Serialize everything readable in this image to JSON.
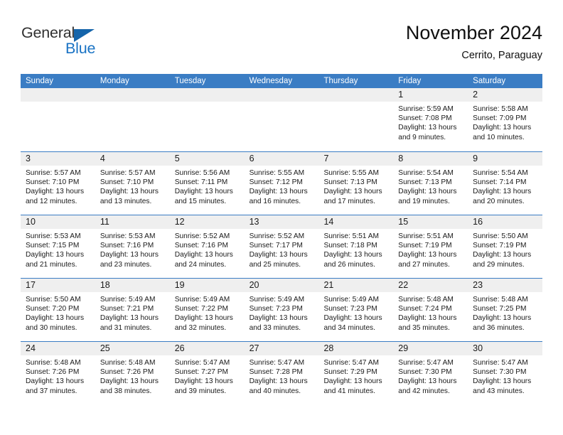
{
  "brand": {
    "name_top": "General",
    "name_bottom": "Blue",
    "triangle_color": "#1464aa",
    "top_color": "#303030",
    "bottom_color": "#1a73c4"
  },
  "header": {
    "title": "November 2024",
    "subtitle": "Cerrito, Paraguay"
  },
  "theme": {
    "header_bg": "#3b7dc4",
    "row_divider": "#3b7dc4",
    "daynum_bg": "#efefef",
    "text": "#1a1a1a"
  },
  "weekdays": [
    "Sunday",
    "Monday",
    "Tuesday",
    "Wednesday",
    "Thursday",
    "Friday",
    "Saturday"
  ],
  "labels": {
    "sunrise_prefix": "Sunrise:",
    "sunset_prefix": "Sunset:",
    "daylight_prefix": "Daylight:"
  },
  "weeks": [
    [
      {
        "day": "",
        "sunrise": "",
        "sunset": "",
        "daylight": "",
        "empty": true
      },
      {
        "day": "",
        "sunrise": "",
        "sunset": "",
        "daylight": "",
        "empty": true
      },
      {
        "day": "",
        "sunrise": "",
        "sunset": "",
        "daylight": "",
        "empty": true
      },
      {
        "day": "",
        "sunrise": "",
        "sunset": "",
        "daylight": "",
        "empty": true
      },
      {
        "day": "",
        "sunrise": "",
        "sunset": "",
        "daylight": "",
        "empty": true
      },
      {
        "day": "1",
        "sunrise": "Sunrise: 5:59 AM",
        "sunset": "Sunset: 7:08 PM",
        "daylight": "Daylight: 13 hours and 9 minutes.",
        "empty": false
      },
      {
        "day": "2",
        "sunrise": "Sunrise: 5:58 AM",
        "sunset": "Sunset: 7:09 PM",
        "daylight": "Daylight: 13 hours and 10 minutes.",
        "empty": false
      }
    ],
    [
      {
        "day": "3",
        "sunrise": "Sunrise: 5:57 AM",
        "sunset": "Sunset: 7:10 PM",
        "daylight": "Daylight: 13 hours and 12 minutes.",
        "empty": false
      },
      {
        "day": "4",
        "sunrise": "Sunrise: 5:57 AM",
        "sunset": "Sunset: 7:10 PM",
        "daylight": "Daylight: 13 hours and 13 minutes.",
        "empty": false
      },
      {
        "day": "5",
        "sunrise": "Sunrise: 5:56 AM",
        "sunset": "Sunset: 7:11 PM",
        "daylight": "Daylight: 13 hours and 15 minutes.",
        "empty": false
      },
      {
        "day": "6",
        "sunrise": "Sunrise: 5:55 AM",
        "sunset": "Sunset: 7:12 PM",
        "daylight": "Daylight: 13 hours and 16 minutes.",
        "empty": false
      },
      {
        "day": "7",
        "sunrise": "Sunrise: 5:55 AM",
        "sunset": "Sunset: 7:13 PM",
        "daylight": "Daylight: 13 hours and 17 minutes.",
        "empty": false
      },
      {
        "day": "8",
        "sunrise": "Sunrise: 5:54 AM",
        "sunset": "Sunset: 7:13 PM",
        "daylight": "Daylight: 13 hours and 19 minutes.",
        "empty": false
      },
      {
        "day": "9",
        "sunrise": "Sunrise: 5:54 AM",
        "sunset": "Sunset: 7:14 PM",
        "daylight": "Daylight: 13 hours and 20 minutes.",
        "empty": false
      }
    ],
    [
      {
        "day": "10",
        "sunrise": "Sunrise: 5:53 AM",
        "sunset": "Sunset: 7:15 PM",
        "daylight": "Daylight: 13 hours and 21 minutes.",
        "empty": false
      },
      {
        "day": "11",
        "sunrise": "Sunrise: 5:53 AM",
        "sunset": "Sunset: 7:16 PM",
        "daylight": "Daylight: 13 hours and 23 minutes.",
        "empty": false
      },
      {
        "day": "12",
        "sunrise": "Sunrise: 5:52 AM",
        "sunset": "Sunset: 7:16 PM",
        "daylight": "Daylight: 13 hours and 24 minutes.",
        "empty": false
      },
      {
        "day": "13",
        "sunrise": "Sunrise: 5:52 AM",
        "sunset": "Sunset: 7:17 PM",
        "daylight": "Daylight: 13 hours and 25 minutes.",
        "empty": false
      },
      {
        "day": "14",
        "sunrise": "Sunrise: 5:51 AM",
        "sunset": "Sunset: 7:18 PM",
        "daylight": "Daylight: 13 hours and 26 minutes.",
        "empty": false
      },
      {
        "day": "15",
        "sunrise": "Sunrise: 5:51 AM",
        "sunset": "Sunset: 7:19 PM",
        "daylight": "Daylight: 13 hours and 27 minutes.",
        "empty": false
      },
      {
        "day": "16",
        "sunrise": "Sunrise: 5:50 AM",
        "sunset": "Sunset: 7:19 PM",
        "daylight": "Daylight: 13 hours and 29 minutes.",
        "empty": false
      }
    ],
    [
      {
        "day": "17",
        "sunrise": "Sunrise: 5:50 AM",
        "sunset": "Sunset: 7:20 PM",
        "daylight": "Daylight: 13 hours and 30 minutes.",
        "empty": false
      },
      {
        "day": "18",
        "sunrise": "Sunrise: 5:49 AM",
        "sunset": "Sunset: 7:21 PM",
        "daylight": "Daylight: 13 hours and 31 minutes.",
        "empty": false
      },
      {
        "day": "19",
        "sunrise": "Sunrise: 5:49 AM",
        "sunset": "Sunset: 7:22 PM",
        "daylight": "Daylight: 13 hours and 32 minutes.",
        "empty": false
      },
      {
        "day": "20",
        "sunrise": "Sunrise: 5:49 AM",
        "sunset": "Sunset: 7:23 PM",
        "daylight": "Daylight: 13 hours and 33 minutes.",
        "empty": false
      },
      {
        "day": "21",
        "sunrise": "Sunrise: 5:49 AM",
        "sunset": "Sunset: 7:23 PM",
        "daylight": "Daylight: 13 hours and 34 minutes.",
        "empty": false
      },
      {
        "day": "22",
        "sunrise": "Sunrise: 5:48 AM",
        "sunset": "Sunset: 7:24 PM",
        "daylight": "Daylight: 13 hours and 35 minutes.",
        "empty": false
      },
      {
        "day": "23",
        "sunrise": "Sunrise: 5:48 AM",
        "sunset": "Sunset: 7:25 PM",
        "daylight": "Daylight: 13 hours and 36 minutes.",
        "empty": false
      }
    ],
    [
      {
        "day": "24",
        "sunrise": "Sunrise: 5:48 AM",
        "sunset": "Sunset: 7:26 PM",
        "daylight": "Daylight: 13 hours and 37 minutes.",
        "empty": false
      },
      {
        "day": "25",
        "sunrise": "Sunrise: 5:48 AM",
        "sunset": "Sunset: 7:26 PM",
        "daylight": "Daylight: 13 hours and 38 minutes.",
        "empty": false
      },
      {
        "day": "26",
        "sunrise": "Sunrise: 5:47 AM",
        "sunset": "Sunset: 7:27 PM",
        "daylight": "Daylight: 13 hours and 39 minutes.",
        "empty": false
      },
      {
        "day": "27",
        "sunrise": "Sunrise: 5:47 AM",
        "sunset": "Sunset: 7:28 PM",
        "daylight": "Daylight: 13 hours and 40 minutes.",
        "empty": false
      },
      {
        "day": "28",
        "sunrise": "Sunrise: 5:47 AM",
        "sunset": "Sunset: 7:29 PM",
        "daylight": "Daylight: 13 hours and 41 minutes.",
        "empty": false
      },
      {
        "day": "29",
        "sunrise": "Sunrise: 5:47 AM",
        "sunset": "Sunset: 7:30 PM",
        "daylight": "Daylight: 13 hours and 42 minutes.",
        "empty": false
      },
      {
        "day": "30",
        "sunrise": "Sunrise: 5:47 AM",
        "sunset": "Sunset: 7:30 PM",
        "daylight": "Daylight: 13 hours and 43 minutes.",
        "empty": false
      }
    ]
  ]
}
